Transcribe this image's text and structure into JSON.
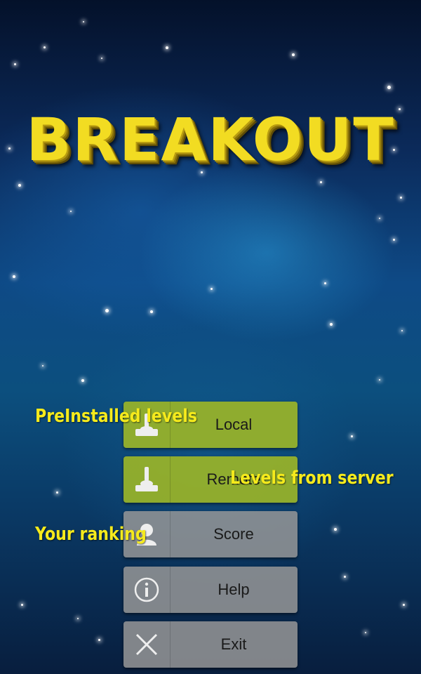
{
  "game": {
    "title": "BREAKOUT"
  },
  "menu": {
    "local": {
      "label": "Local",
      "icon": "joystick-icon"
    },
    "remote": {
      "label": "Remote",
      "icon": "joystick-icon"
    },
    "score": {
      "label": "Score",
      "icon": "user-icon"
    },
    "help": {
      "label": "Help",
      "icon": "info-icon"
    },
    "exit": {
      "label": "Exit",
      "icon": "close-icon"
    }
  },
  "annotations": {
    "local": "PreInstalled levels",
    "remote": "Levels from server",
    "score": "Your ranking"
  },
  "colors": {
    "title": "#f2dc22",
    "button_active": "#9ab428",
    "button_default": "#969696",
    "annotation": "#f5ea1c"
  }
}
